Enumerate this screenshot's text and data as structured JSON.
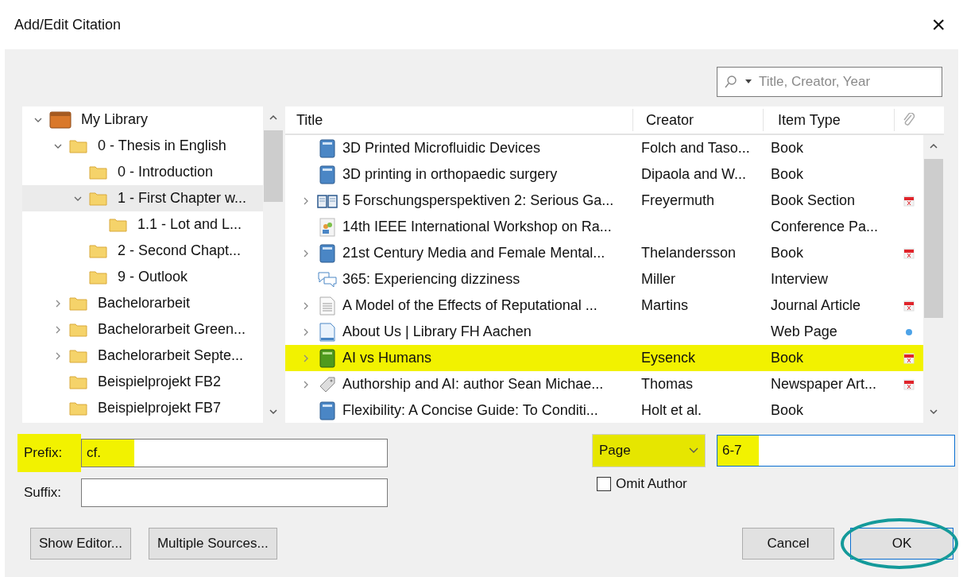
{
  "window": {
    "title": "Add/Edit Citation",
    "close": "×"
  },
  "search": {
    "placeholder": "Title, Creator, Year"
  },
  "tree": [
    {
      "label": "My Library",
      "kind": "library",
      "expanded": true,
      "selected": false,
      "children": [
        {
          "label": "0 - Thesis in English",
          "kind": "folder",
          "expanded": true,
          "selected": false,
          "children": [
            {
              "label": "0 - Introduction",
              "kind": "folder",
              "selected": false
            },
            {
              "label": "1 - First Chapter w...",
              "kind": "folder",
              "expanded": true,
              "selected": true,
              "children": [
                {
                  "label": "1.1 - Lot and L...",
                  "kind": "folder",
                  "selected": false
                }
              ]
            },
            {
              "label": "2 - Second Chapt...",
              "kind": "folder",
              "selected": false
            },
            {
              "label": "9 - Outlook",
              "kind": "folder",
              "selected": false
            }
          ]
        },
        {
          "label": "Bachelorarbeit",
          "kind": "folder",
          "expanded": false,
          "selected": false
        },
        {
          "label": "Bachelorarbeit Green...",
          "kind": "folder",
          "expanded": false,
          "selected": false
        },
        {
          "label": "Bachelorarbeit Septe...",
          "kind": "folder",
          "expanded": false,
          "selected": false
        },
        {
          "label": "Beispielprojekt FB2",
          "kind": "folder",
          "selected": false
        },
        {
          "label": "Beispielprojekt FB7",
          "kind": "folder",
          "selected": false
        }
      ]
    }
  ],
  "table": {
    "columns": [
      "Title",
      "Creator",
      "Item Type"
    ],
    "rows": [
      {
        "title": "3D Printed Microfluidic Devices",
        "creator": "Folch and Taso...",
        "item_type": "Book",
        "kind": "book",
        "highlighted": false
      },
      {
        "title": "3D printing in orthopaedic surgery",
        "creator": "Dipaola and W...",
        "item_type": "Book",
        "kind": "book",
        "highlighted": false
      },
      {
        "title": "5 Forschungsperspektiven 2: Serious Ga...",
        "creator": "Freyermuth",
        "item_type": "Book Section",
        "kind": "book-section",
        "expanded": false,
        "attachment": {
          "kind": "pdf"
        },
        "highlighted": false
      },
      {
        "title": "14th IEEE International Workshop on Ra...",
        "item_type": "Conference Pa...",
        "kind": "conference",
        "highlighted": false
      },
      {
        "title": "21st Century Media and Female Mental...",
        "creator": "Thelandersson",
        "item_type": "Book",
        "kind": "book",
        "expanded": false,
        "attachment": {
          "kind": "pdf"
        },
        "highlighted": false
      },
      {
        "title": "365: Experiencing dizziness",
        "creator": "Miller",
        "item_type": "Interview",
        "kind": "interview",
        "highlighted": false
      },
      {
        "title": "A Model of the Effects of Reputational ...",
        "creator": "Martins",
        "item_type": "Journal Article",
        "kind": "article",
        "expanded": false,
        "attachment": {
          "kind": "pdf"
        },
        "highlighted": false
      },
      {
        "title": "About Us | Library FH Aachen",
        "item_type": "Web Page",
        "kind": "webpage",
        "expanded": false,
        "attachment": {
          "kind": "snapshot"
        },
        "highlighted": false
      },
      {
        "title": "AI vs Humans",
        "creator": "Eysenck",
        "item_type": "Book",
        "kind": "book-green",
        "expanded": false,
        "attachment": {
          "kind": "pdf"
        },
        "highlighted": true
      },
      {
        "title": "Authorship and AI: author Sean Michae...",
        "creator": "Thomas",
        "item_type": "Newspaper Art...",
        "kind": "newspaper",
        "expanded": false,
        "attachment": {
          "kind": "pdf"
        },
        "highlighted": false
      },
      {
        "title": "Flexibility: A Concise Guide: To Conditi...",
        "creator": "Holt et al.",
        "item_type": "Book",
        "kind": "book",
        "highlighted": false
      }
    ]
  },
  "prefix": {
    "label": "Prefix:",
    "value": "cf.",
    "highlighted": true
  },
  "suffix": {
    "label": "Suffix:"
  },
  "locator": {
    "unit": "Page",
    "value": "6-7",
    "highlighted": true
  },
  "omit_author": {
    "label": "Omit Author",
    "checked": false
  },
  "buttons": [
    {
      "label": "Show Editor...",
      "circled": false
    },
    {
      "label": "Multiple Sources...",
      "circled": false
    },
    {
      "label": "Cancel",
      "circled": false
    },
    {
      "label": "OK",
      "circled": true
    }
  ]
}
